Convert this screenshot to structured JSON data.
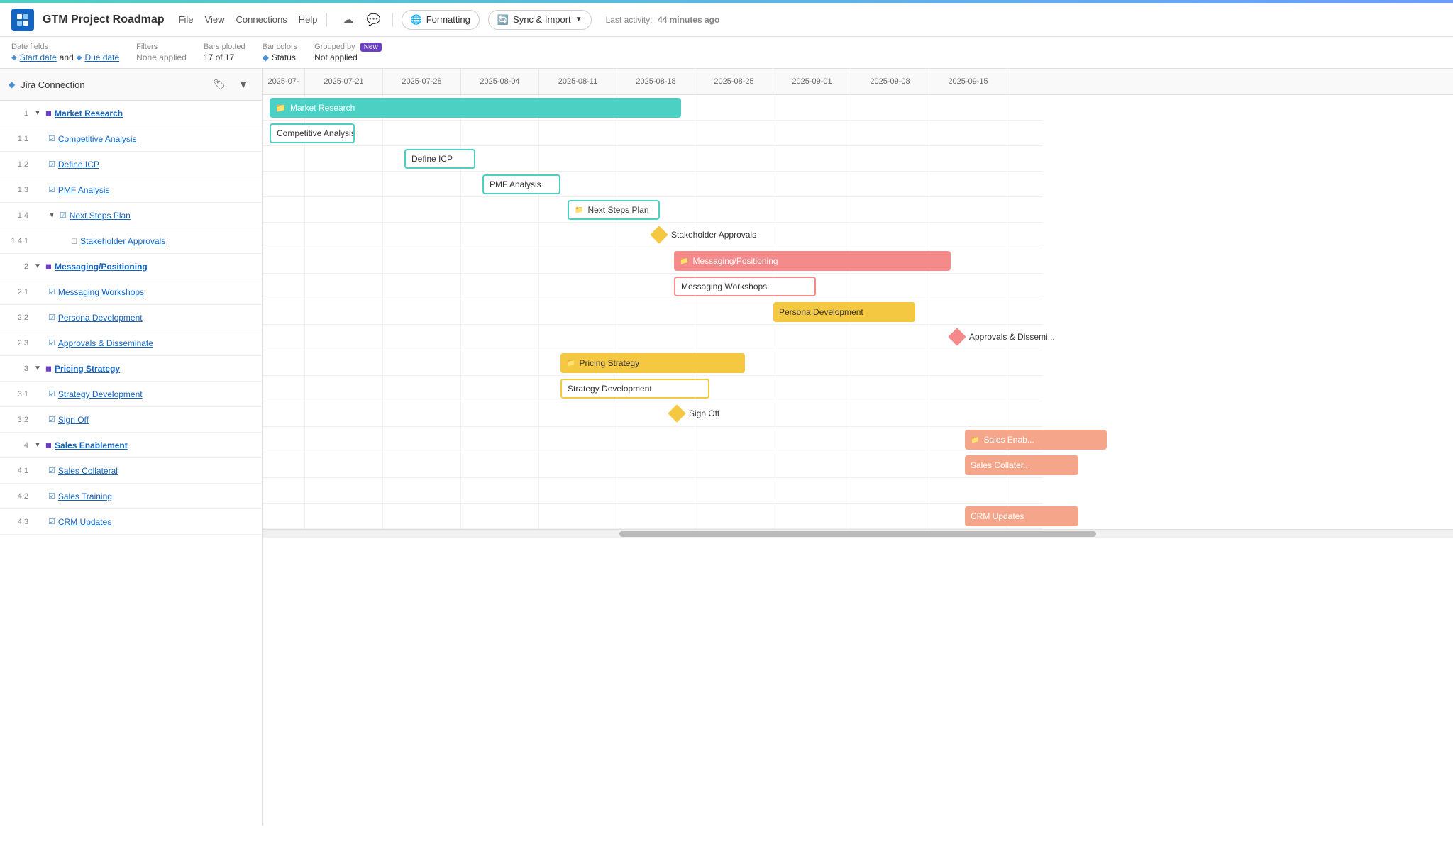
{
  "app": {
    "icon_color": "#1565c0",
    "title": "GTM Project Roadmap"
  },
  "nav": {
    "items": [
      "File",
      "View",
      "Connections",
      "Help"
    ],
    "formatting_label": "Formatting",
    "sync_label": "Sync & Import",
    "last_activity_label": "Last activity:",
    "last_activity_value": "44 minutes ago"
  },
  "toolbar": {
    "date_fields_label": "Date fields",
    "start_date": "Start date",
    "and": "and",
    "due_date": "Due date",
    "filters_label": "Filters",
    "filters_value": "None applied",
    "bars_plotted_label": "Bars plotted",
    "bars_plotted_value": "17 of 17",
    "bar_colors_label": "Bar colors",
    "bar_colors_value": "Status",
    "grouped_by_label": "Grouped by",
    "grouped_by_badge": "New",
    "grouped_by_value": "Not applied"
  },
  "left_panel": {
    "header": "Jira Connection",
    "rows": [
      {
        "num": "1",
        "indent": 1,
        "icon": "folder",
        "caret": true,
        "label": "Market Research",
        "bold": true
      },
      {
        "num": "1.1",
        "indent": 2,
        "icon": "task",
        "caret": false,
        "label": "Competitive Analysis",
        "bold": false
      },
      {
        "num": "1.2",
        "indent": 2,
        "icon": "task",
        "caret": false,
        "label": "Define ICP",
        "bold": false
      },
      {
        "num": "1.3",
        "indent": 2,
        "icon": "task",
        "caret": false,
        "label": "PMF Analysis",
        "bold": false
      },
      {
        "num": "1.4",
        "indent": 2,
        "icon": "folder",
        "caret": true,
        "label": "Next Steps Plan",
        "bold": false
      },
      {
        "num": "1.4.1",
        "indent": 3,
        "icon": "milestone",
        "caret": false,
        "label": "Stakeholder Approvals",
        "bold": false
      },
      {
        "num": "2",
        "indent": 1,
        "icon": "folder",
        "caret": true,
        "label": "Messaging/Positioning",
        "bold": true
      },
      {
        "num": "2.1",
        "indent": 2,
        "icon": "task",
        "caret": false,
        "label": "Messaging Workshops",
        "bold": false
      },
      {
        "num": "2.2",
        "indent": 2,
        "icon": "task",
        "caret": false,
        "label": "Persona Development",
        "bold": false
      },
      {
        "num": "2.3",
        "indent": 2,
        "icon": "task",
        "caret": false,
        "label": "Approvals & Disseminate",
        "bold": false
      },
      {
        "num": "3",
        "indent": 1,
        "icon": "folder",
        "caret": true,
        "label": "Pricing Strategy",
        "bold": true
      },
      {
        "num": "3.1",
        "indent": 2,
        "icon": "task",
        "caret": false,
        "label": "Strategy Development",
        "bold": false
      },
      {
        "num": "3.2",
        "indent": 2,
        "icon": "task",
        "caret": false,
        "label": "Sign Off",
        "bold": false
      },
      {
        "num": "4",
        "indent": 1,
        "icon": "folder",
        "caret": true,
        "label": "Sales Enablement",
        "bold": true
      },
      {
        "num": "4.1",
        "indent": 2,
        "icon": "task",
        "caret": false,
        "label": "Sales Collateral",
        "bold": false
      },
      {
        "num": "4.2",
        "indent": 2,
        "icon": "task",
        "caret": false,
        "label": "Sales Training",
        "bold": false
      },
      {
        "num": "4.3",
        "indent": 2,
        "icon": "task",
        "caret": false,
        "label": "CRM Updates",
        "bold": false
      }
    ]
  },
  "gantt": {
    "columns": [
      "2025-07-",
      "2025-07-21",
      "2025-07-28",
      "2025-08-04",
      "2025-08-11",
      "2025-08-18",
      "2025-08-25",
      "2025-09-01",
      "2025-09-08",
      "2025-09-15"
    ],
    "bars": [
      {
        "row": 0,
        "label": "Market Research",
        "style": "teal",
        "left_pct": 1,
        "width_pct": 52,
        "icon": "folder"
      },
      {
        "row": 1,
        "label": "Competitive Analysis",
        "style": "teal-outline",
        "left_pct": 1,
        "width_pct": 10,
        "icon": null
      },
      {
        "row": 2,
        "label": "Define ICP",
        "style": "teal-outline",
        "left_pct": 18,
        "width_pct": 10,
        "icon": null
      },
      {
        "row": 3,
        "label": "PMF Analysis",
        "style": "teal-outline",
        "left_pct": 29,
        "width_pct": 11,
        "icon": null
      },
      {
        "row": 4,
        "label": "Next Steps Plan",
        "style": "teal-outline",
        "left_pct": 40,
        "width_pct": 12,
        "icon": "folder"
      },
      {
        "row": 5,
        "label": "Stakeholder Approvals",
        "style": "milestone",
        "left_pct": 51,
        "width_pct": 0,
        "icon": null
      },
      {
        "row": 6,
        "label": "Messaging/Positioning",
        "style": "pink",
        "left_pct": 52,
        "width_pct": 37,
        "icon": "folder"
      },
      {
        "row": 7,
        "label": "Messaging Workshops",
        "style": "pink-outline",
        "left_pct": 52,
        "width_pct": 19,
        "icon": null
      },
      {
        "row": 8,
        "label": "Persona Development",
        "style": "yellow",
        "left_pct": 65,
        "width_pct": 18,
        "icon": null
      },
      {
        "row": 9,
        "label": "Approvals & Disseminate",
        "style": "milestone-pink",
        "left_pct": 89,
        "width_pct": 0,
        "icon": null
      },
      {
        "row": 10,
        "label": "Pricing Strategy",
        "style": "yellow",
        "left_pct": 37,
        "width_pct": 24,
        "icon": "folder"
      },
      {
        "row": 11,
        "label": "Strategy Development",
        "style": "yellow-outline",
        "left_pct": 37,
        "width_pct": 20,
        "icon": null
      },
      {
        "row": 12,
        "label": "Sign Off",
        "style": "milestone-yellow",
        "left_pct": 52,
        "width_pct": 0,
        "icon": null
      },
      {
        "row": 13,
        "label": "Sales Enablement",
        "style": "salmon",
        "left_pct": 90,
        "width_pct": 20,
        "icon": "folder"
      },
      {
        "row": 14,
        "label": "Sales Collateral",
        "style": "salmon",
        "left_pct": 90,
        "width_pct": 15,
        "icon": null
      },
      {
        "row": 15,
        "label": "",
        "style": "none",
        "left_pct": 0,
        "width_pct": 0,
        "icon": null
      },
      {
        "row": 16,
        "label": "CRM Updates",
        "style": "salmon",
        "left_pct": 90,
        "width_pct": 15,
        "icon": null
      }
    ]
  }
}
